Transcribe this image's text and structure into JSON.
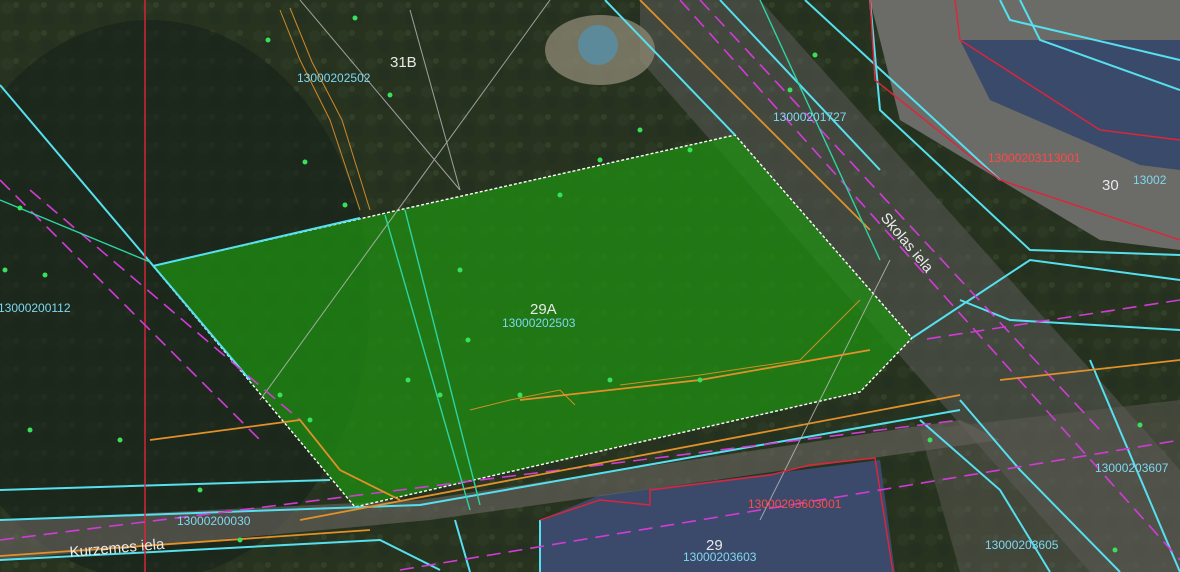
{
  "map": {
    "selected_parcel": {
      "number": "29A",
      "cadastral_id": "13000202503",
      "fill_color": "#1f8f12"
    },
    "parcel_labels": {
      "p1": "13000202502",
      "p2": "13000201727",
      "p3": "13000200112",
      "p4": "13000200030",
      "p5": "13000203603",
      "p6": "13000203605",
      "p7": "13000203607",
      "p8": "13002"
    },
    "building_labels": {
      "b1": "13000203113001",
      "b2": "13000203603001"
    },
    "house_numbers": {
      "h1": "31B",
      "h2": "30",
      "h3": "29"
    },
    "streets": {
      "s1": "Skolas iela",
      "s2": "Kurzemes iela"
    },
    "colors": {
      "boundary_cyan": "#56e0ef",
      "building_red": "#e0243a",
      "utility_magenta": "#d23bd6",
      "utility_orange": "#e2912a",
      "label_cyan": "#7fd8f0",
      "label_red": "#ff4a4a"
    }
  }
}
